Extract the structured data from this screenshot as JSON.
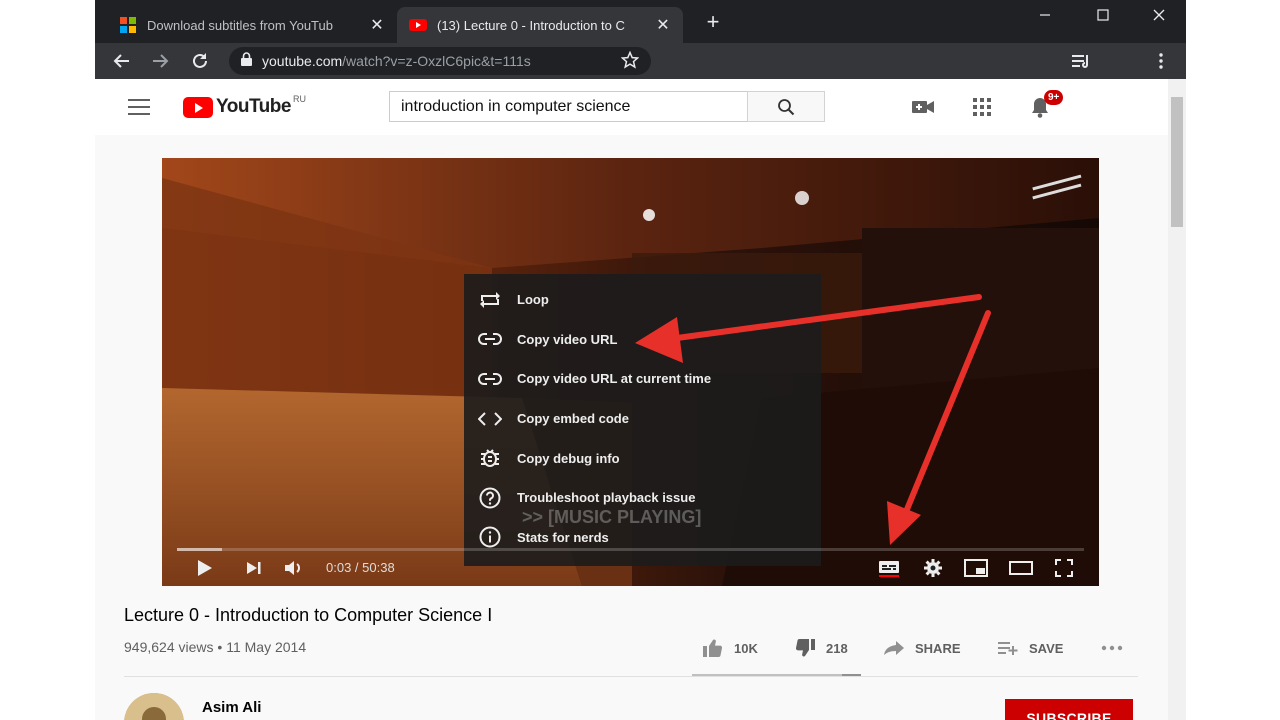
{
  "browser": {
    "tabs": [
      {
        "title": "Download subtitles from YouTub",
        "favicon": "microsoft-grid-icon",
        "active": false
      },
      {
        "title": "(13) Lecture 0 - Introduction to C",
        "favicon": "youtube-icon",
        "active": true
      }
    ],
    "url_domain": "youtube.com",
    "url_path": "/watch?v=z-OxzlC6pic&t=111s"
  },
  "youtube": {
    "region": "RU",
    "search_query": "introduction in computer science",
    "notification_count": "9+",
    "context_menu": [
      {
        "label": "Loop",
        "icon": "loop-icon"
      },
      {
        "label": "Copy video URL",
        "icon": "link-icon"
      },
      {
        "label": "Copy video URL at current time",
        "icon": "link-icon"
      },
      {
        "label": "Copy embed code",
        "icon": "code-icon"
      },
      {
        "label": "Copy debug info",
        "icon": "bug-icon"
      },
      {
        "label": "Troubleshoot playback issue",
        "icon": "help-icon"
      },
      {
        "label": "Stats for nerds",
        "icon": "info-icon"
      }
    ],
    "caption_text": ">> [MUSIC PLAYING]",
    "player": {
      "time_current": "0:03",
      "time_sep": " / ",
      "time_total": "50:38",
      "progress_fraction": 0.05
    },
    "video": {
      "title": "Lecture 0 - Introduction to Computer Science I",
      "views": "949,624 views",
      "dot": " • ",
      "date": "11 May 2014",
      "likes": "10K",
      "dislikes": "218",
      "share_label": "SHARE",
      "save_label": "SAVE",
      "like_fraction": 0.89
    },
    "channel": {
      "name": "Asim Ali",
      "subscribe_label": "SUBSCRIBE"
    }
  },
  "colors": {
    "accent_red": "#ff0000",
    "subscribe_red": "#cc0000",
    "annotation_arrow": "#e8302a"
  }
}
